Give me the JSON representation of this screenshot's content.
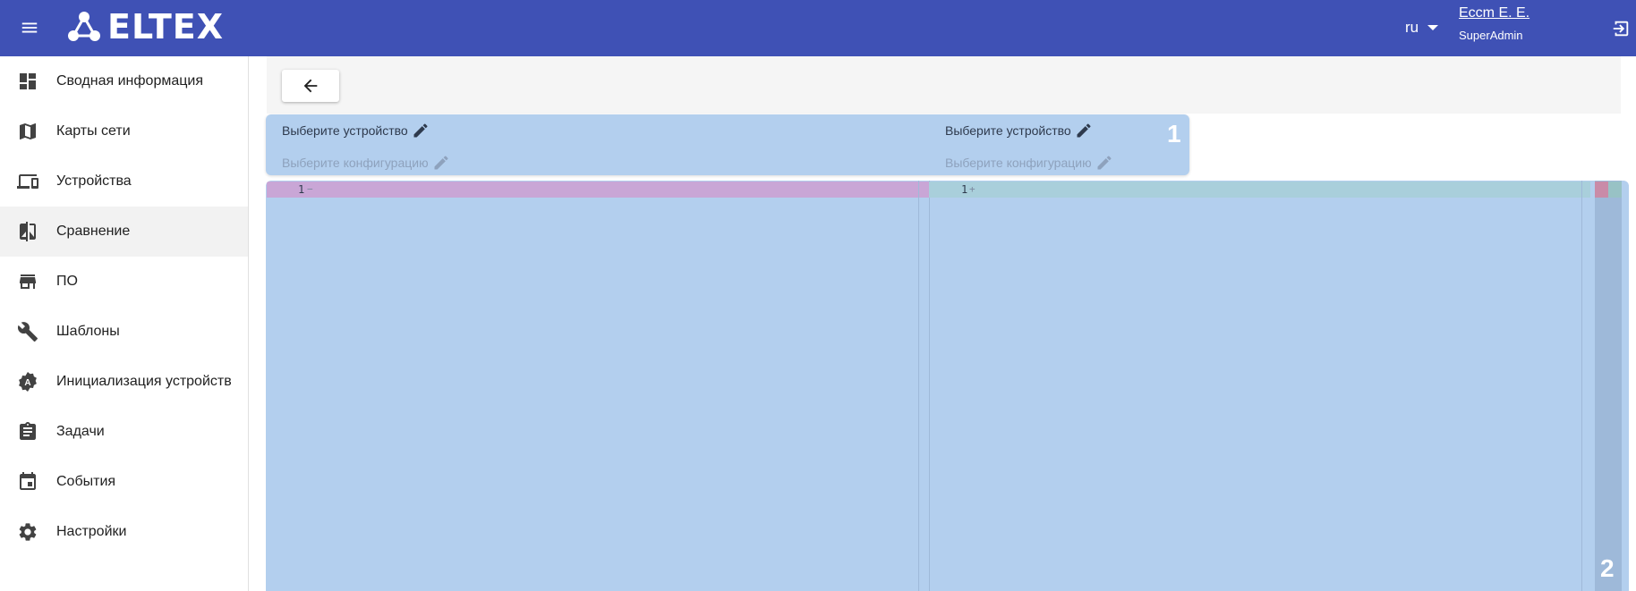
{
  "header": {
    "brand": "ELTEX",
    "language": "ru",
    "user_name": "Eccm E. E.",
    "user_role": "SuperAdmin",
    "bg_color": "#3f51b5"
  },
  "sidebar": {
    "items": [
      {
        "label": "Сводная информация",
        "icon": "dashboard-icon"
      },
      {
        "label": "Карты сети",
        "icon": "map-icon"
      },
      {
        "label": "Устройства",
        "icon": "devices-icon"
      },
      {
        "label": "Сравнение",
        "icon": "compare-icon",
        "active": true
      },
      {
        "label": "ПО",
        "icon": "store-icon"
      },
      {
        "label": "Шаблоны",
        "icon": "wrench-icon"
      },
      {
        "label": "Инициализация устройств",
        "icon": "auto-badge-icon"
      },
      {
        "label": "Задачи",
        "icon": "clipboard-icon"
      },
      {
        "label": "События",
        "icon": "calendar-icon"
      },
      {
        "label": "Настройки",
        "icon": "gear-icon"
      }
    ]
  },
  "toolbar": {
    "back_icon": "arrow-left-icon"
  },
  "compare": {
    "left": {
      "device_label": "Выберите устройство",
      "config_label": "Выберите конфигурацию"
    },
    "right": {
      "device_label": "Выберите устройство",
      "config_label": "Выберите конфигурацию"
    },
    "selector_badge": "1",
    "diff_badge": "2",
    "left_line_number": "1",
    "left_line_marker": "−",
    "right_line_number": "1",
    "right_line_marker": "+",
    "removed_color": "#c9a6d6",
    "added_color": "#a9cfdb"
  }
}
